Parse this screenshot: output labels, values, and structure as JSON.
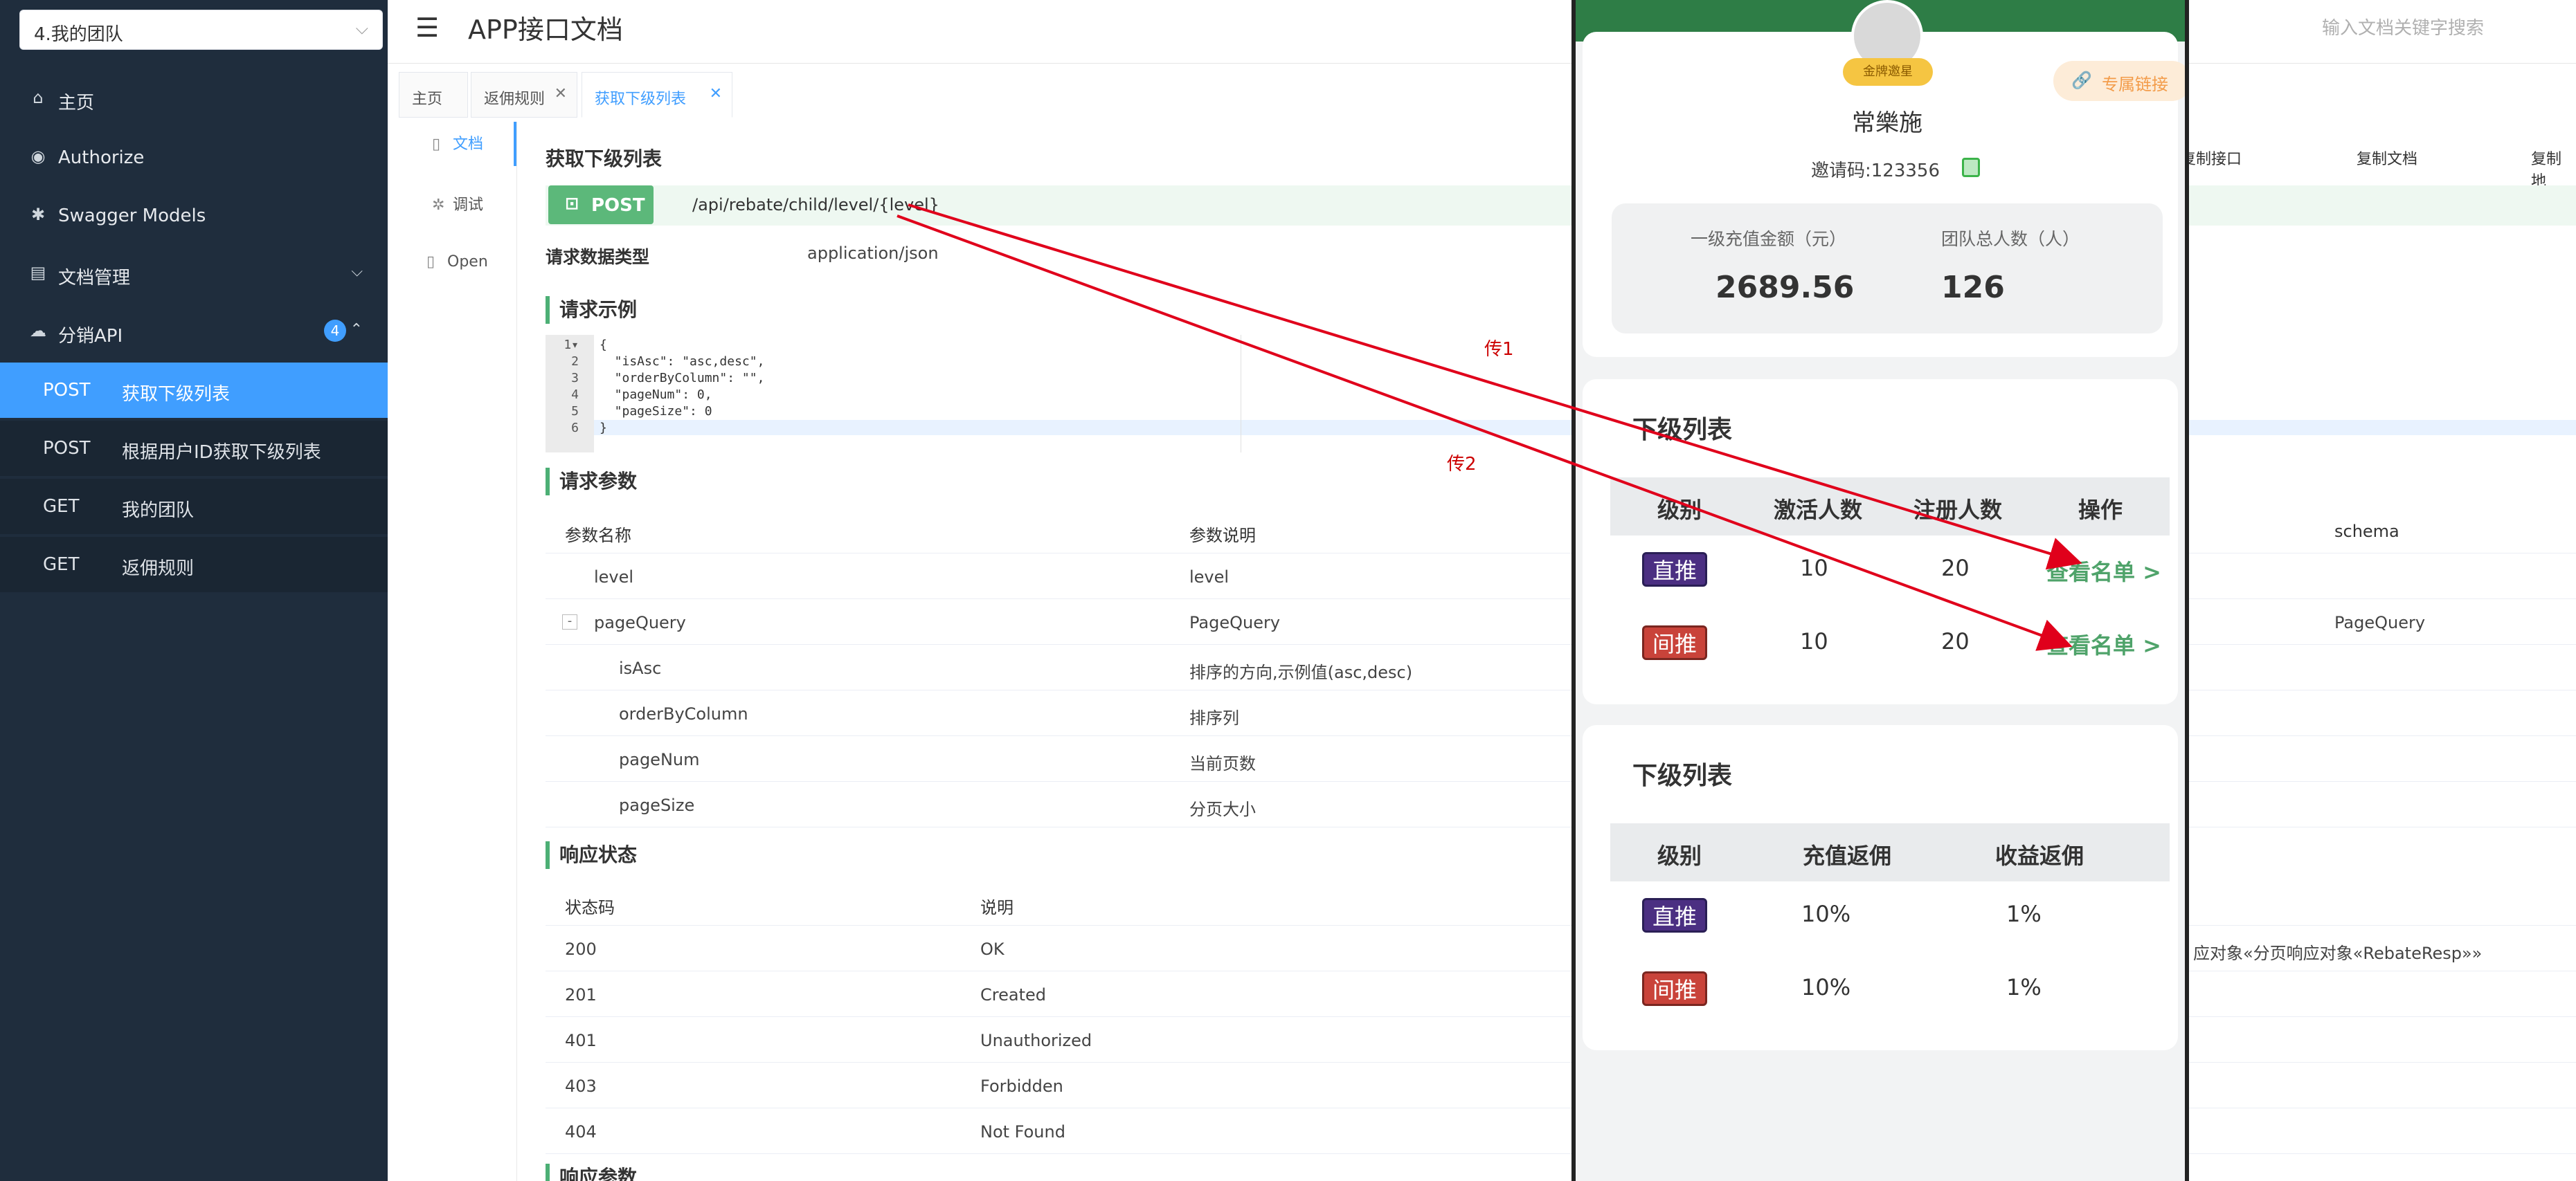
{
  "sidebar": {
    "team_select": "4.我的团队",
    "items": [
      {
        "label": "主页",
        "icon": "home-icon"
      },
      {
        "label": "Authorize",
        "icon": "lock-icon"
      },
      {
        "label": "Swagger Models",
        "icon": "gear-icon"
      },
      {
        "label": "文档管理",
        "icon": "document-icon"
      },
      {
        "label": "分销API",
        "icon": "cloud-icon",
        "badge": "4"
      }
    ],
    "sub_items": [
      {
        "method": "POST",
        "label": "获取下级列表",
        "active": true
      },
      {
        "method": "POST",
        "label": "根据用户ID获取下级列表"
      },
      {
        "method": "GET",
        "label": "我的团队"
      },
      {
        "method": "GET",
        "label": "返佣规则"
      }
    ]
  },
  "header": {
    "title": "APP接口文档",
    "search_placeholder": "输入文档关键字搜索"
  },
  "tabs": [
    {
      "label": "主页"
    },
    {
      "label": "返佣规则"
    },
    {
      "label": "获取下级列表",
      "active": true
    }
  ],
  "modes": [
    "文档",
    "调试",
    "Open"
  ],
  "doc": {
    "title": "获取下级列表",
    "method": "POST",
    "path": "/api/rebate/child/level/{level}",
    "content_type_label": "请求数据类型",
    "content_type": "application/json",
    "copy_links": [
      "复制接口",
      "复制文档",
      "复制地"
    ],
    "example_title": "请求示例",
    "code_lines": [
      "{",
      "  \"isAsc\": \"asc,desc\",",
      "  \"orderByColumn\": \"\",",
      "  \"pageNum\": 0,",
      "  \"pageSize\": 0",
      "}"
    ],
    "params_title": "请求参数",
    "params_headers": [
      "参数名称",
      "参数说明",
      "schema"
    ],
    "params": [
      {
        "name": "level",
        "desc": "level",
        "schema": ""
      },
      {
        "name": "pageQuery",
        "desc": "PageQuery",
        "schema": "PageQuery",
        "toggle": "-"
      },
      {
        "name": "isAsc",
        "desc": "排序的方向,示例值(asc,desc)",
        "schema": ""
      },
      {
        "name": "orderByColumn",
        "desc": "排序列",
        "schema": ""
      },
      {
        "name": "pageNum",
        "desc": "当前页数",
        "schema": ""
      },
      {
        "name": "pageSize",
        "desc": "分页大小",
        "schema": ""
      }
    ],
    "status_title": "响应状态",
    "status_headers": [
      "状态码",
      "说明"
    ],
    "statuses": [
      {
        "code": "200",
        "desc": "OK",
        "schema": "应对象«分页响应对象«RebateResp»»"
      },
      {
        "code": "201",
        "desc": "Created"
      },
      {
        "code": "401",
        "desc": "Unauthorized"
      },
      {
        "code": "403",
        "desc": "Forbidden"
      },
      {
        "code": "404",
        "desc": "Not Found"
      }
    ],
    "resp_params_title": "响应参数"
  },
  "phone": {
    "badge": "金牌邀星",
    "link_label": "专属链接",
    "nickname": "常樂施",
    "invite": "邀请码:123356",
    "stats": [
      {
        "label": "一级充值金额（元）",
        "value": "2689.56"
      },
      {
        "label": "团队总人数（人）",
        "value": "126"
      }
    ],
    "list1": {
      "title": "下级列表",
      "headers": [
        "级别",
        "激活人数",
        "注册人数",
        "操作"
      ],
      "rows": [
        {
          "level": "直推",
          "active": "10",
          "registered": "20",
          "action": "查看名单 >"
        },
        {
          "level": "间推",
          "active": "10",
          "registered": "20",
          "action": "查看名单 >"
        }
      ]
    },
    "list2": {
      "title": "下级列表",
      "headers": [
        "级别",
        "充值返佣",
        "收益返佣"
      ],
      "rows": [
        {
          "level": "直推",
          "recharge": "10%",
          "profit": "1%"
        },
        {
          "level": "间推",
          "recharge": "10%",
          "profit": "1%"
        }
      ]
    }
  },
  "annotations": {
    "a1": "传1",
    "a2": "传2"
  },
  "colors": {
    "sidebar": "#1f2d3d",
    "accent": "#409eff",
    "post": "#5cb87a",
    "arrow": "#e0001b"
  }
}
